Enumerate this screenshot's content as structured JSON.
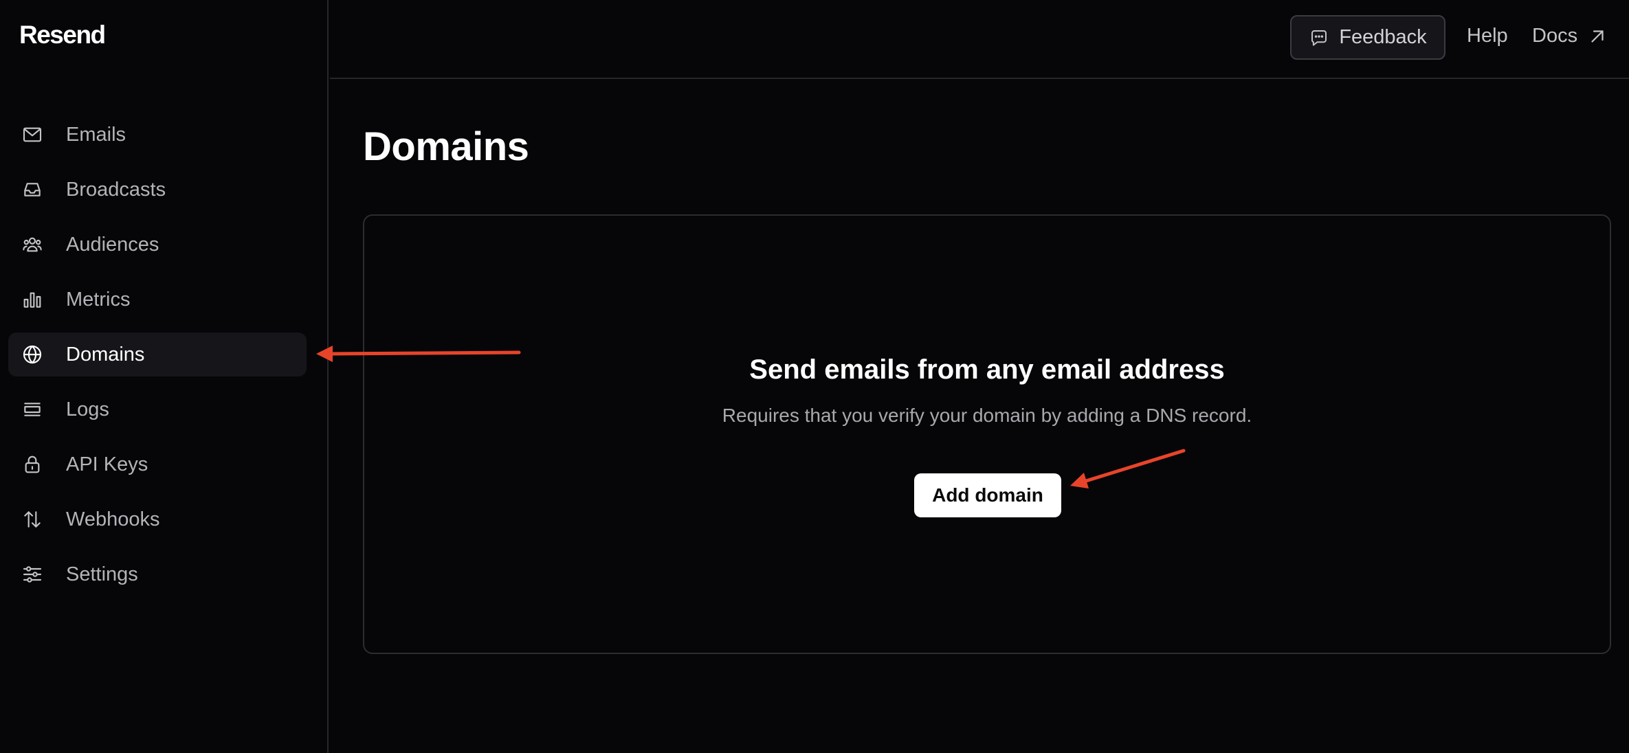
{
  "app": {
    "logo": "Resend"
  },
  "sidebar": {
    "items": [
      {
        "label": "Emails",
        "icon": "mail-icon",
        "active": false
      },
      {
        "label": "Broadcasts",
        "icon": "inbox-icon",
        "active": false
      },
      {
        "label": "Audiences",
        "icon": "users-icon",
        "active": false
      },
      {
        "label": "Metrics",
        "icon": "bar-chart-icon",
        "active": false
      },
      {
        "label": "Domains",
        "icon": "globe-icon",
        "active": true
      },
      {
        "label": "Logs",
        "icon": "logs-icon",
        "active": false
      },
      {
        "label": "API Keys",
        "icon": "lock-icon",
        "active": false
      },
      {
        "label": "Webhooks",
        "icon": "arrows-up-down-icon",
        "active": false
      },
      {
        "label": "Settings",
        "icon": "sliders-icon",
        "active": false
      }
    ]
  },
  "topbar": {
    "feedback_label": "Feedback",
    "feedback_icon": "chat-bubble-icon",
    "help_label": "Help",
    "docs_label": "Docs",
    "docs_icon": "arrow-up-right-icon"
  },
  "main": {
    "page_title": "Domains",
    "empty_state": {
      "title": "Send emails from any email address",
      "subtitle": "Requires that you verify your domain by adding a DNS record.",
      "button_label": "Add domain"
    }
  },
  "colors": {
    "background": "#060609",
    "annotation_arrow": "#e8442a",
    "primary_button": "#ffffff"
  }
}
